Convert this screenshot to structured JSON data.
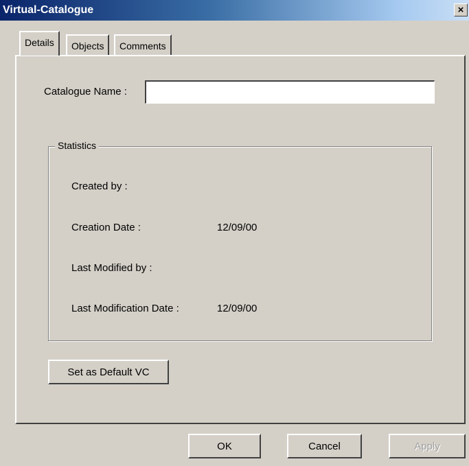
{
  "window": {
    "title": "Virtual-Catalogue",
    "close_glyph": "×"
  },
  "tabs": [
    {
      "label": "Details",
      "active": true
    },
    {
      "label": "Objects",
      "active": false
    },
    {
      "label": "Comments",
      "active": false
    }
  ],
  "details": {
    "catalogue_name_label": "Catalogue Name :",
    "catalogue_name_value": "",
    "statistics": {
      "legend": "Statistics",
      "created_by_label": "Created by :",
      "created_by_value": "",
      "creation_date_label": "Creation Date :",
      "creation_date_value": "12/09/00",
      "last_modified_by_label": "Last Modified by :",
      "last_modified_by_value": "",
      "last_modification_date_label": "Last Modification Date :",
      "last_modification_date_value": "12/09/00"
    },
    "set_default_label": "Set as Default VC"
  },
  "buttons": {
    "ok": "OK",
    "cancel": "Cancel",
    "apply": "Apply"
  },
  "colors": {
    "face": "#d4d0c8",
    "title_start": "#0a246a",
    "title_end": "#a6caf0"
  }
}
